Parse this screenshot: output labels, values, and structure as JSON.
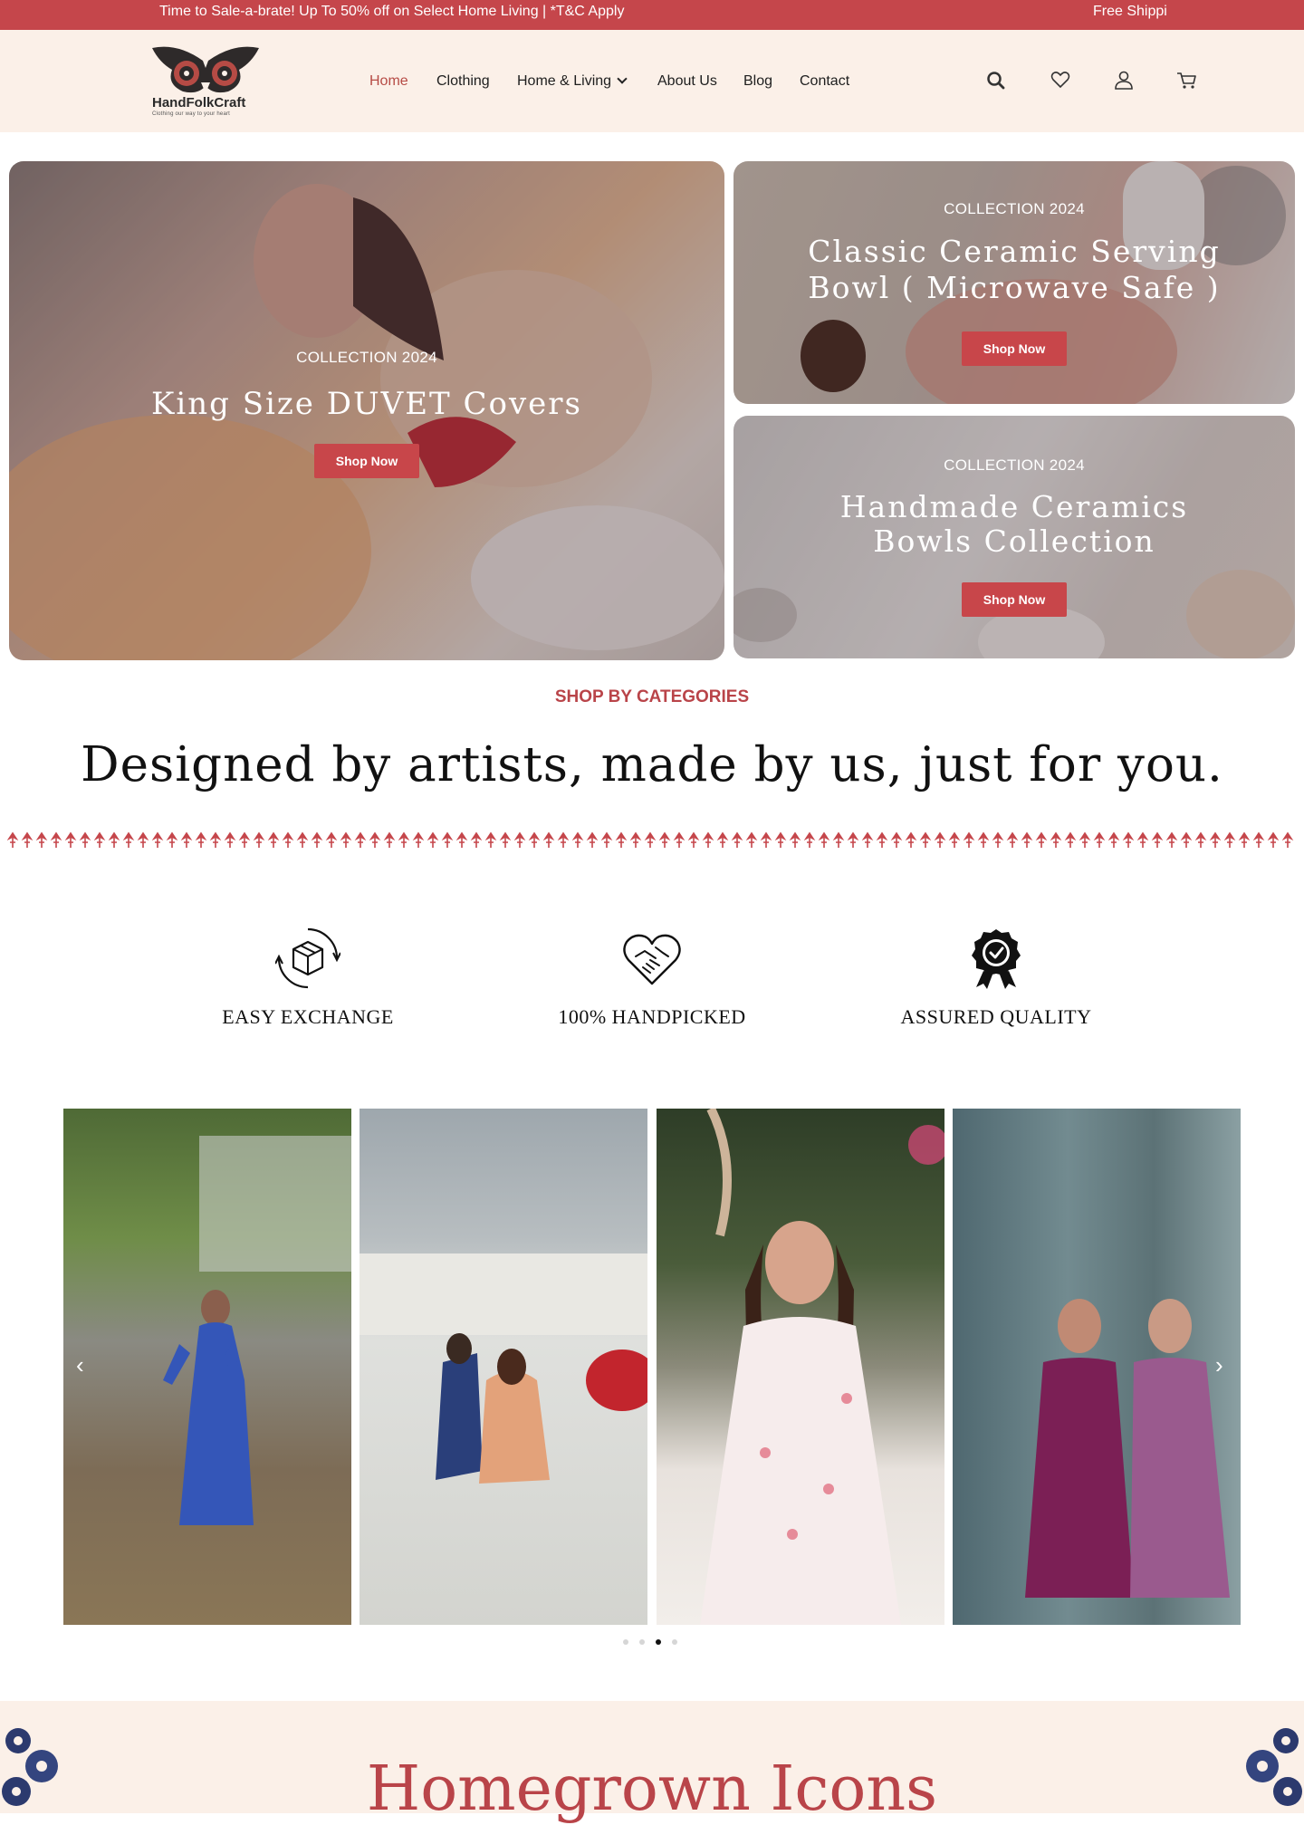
{
  "announcement": {
    "promo": "Time to Sale-a-brate! Up To 50% off on Select Home Living | *T&C Apply",
    "shipping": "Free Shippi"
  },
  "brand": {
    "name": "HandFolkCraft",
    "tagline": "Clothing our way to your heart",
    "accent": "#c5464b",
    "header_bg": "#fbf0e8"
  },
  "nav": {
    "home": "Home",
    "clothing": "Clothing",
    "home_living": "Home & Living",
    "about": "About Us",
    "blog": "Blog",
    "contact": "Contact"
  },
  "header_icons": [
    "search-icon",
    "heart-icon",
    "user-icon",
    "cart-icon"
  ],
  "hero": {
    "main": {
      "eyebrow": "COLLECTION 2024",
      "title": "King Size DUVET Covers",
      "button": "Shop Now"
    },
    "top_right": {
      "eyebrow": "COLLECTION 2024",
      "title_line1": "Classic Ceramic Serving",
      "title_line2": "Bowl ( Microwave Safe )",
      "button": "Shop Now"
    },
    "bottom_right": {
      "eyebrow": "COLLECTION 2024",
      "title_line1": "Handmade Ceramics",
      "title_line2": "Bowls Collection",
      "button": "Shop Now"
    }
  },
  "categories": {
    "eyebrow": "SHOP BY CATEGORIES",
    "title": "Designed by artists, made by us, just for you."
  },
  "features": [
    {
      "icon": "box-exchange-icon",
      "label": "EASY EXCHANGE"
    },
    {
      "icon": "heart-handshake-icon",
      "label": "100% HANDPICKED"
    },
    {
      "icon": "quality-badge-icon",
      "label": "ASSURED QUALITY"
    }
  ],
  "gallery": {
    "slides": [
      "blue-floral-wrap-dress",
      "orange-organza-dress",
      "white-floral-dress",
      "purple-floral-dresses"
    ],
    "dots_total": 4,
    "active_dot": 3
  },
  "homegrown": {
    "title": "Homegrown Icons"
  }
}
